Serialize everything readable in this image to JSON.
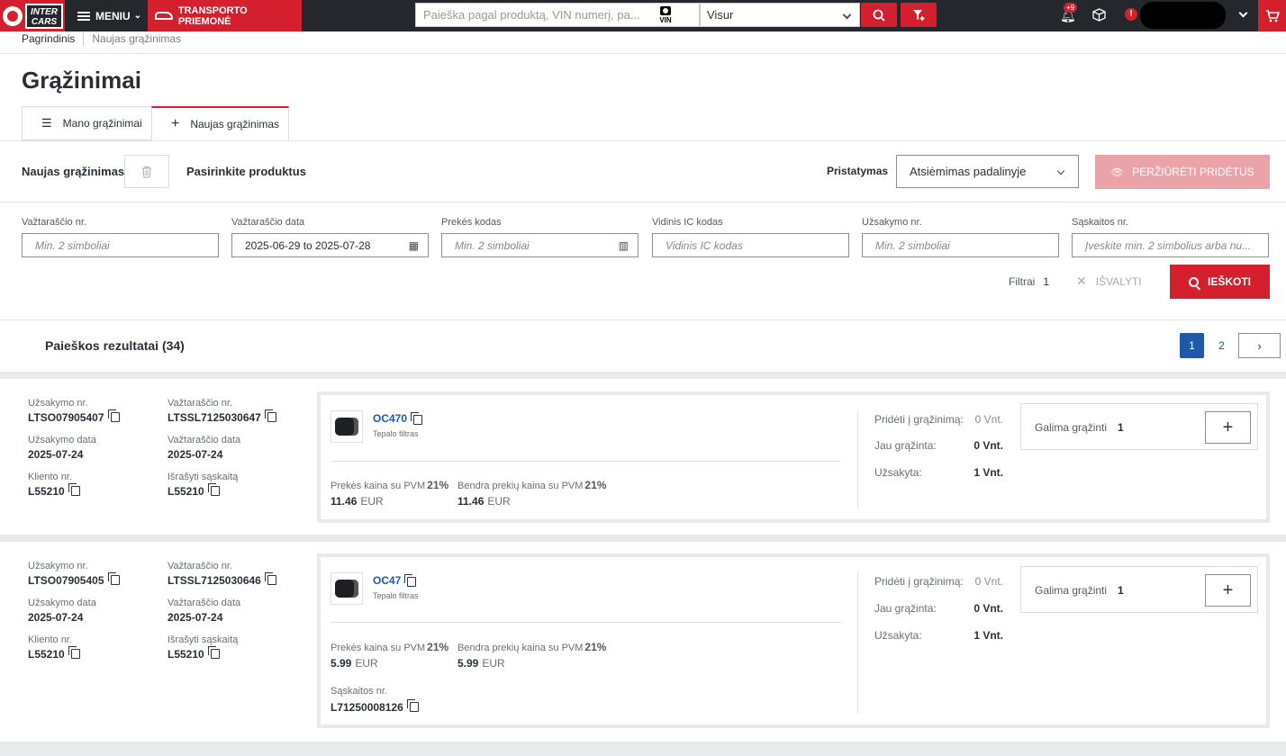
{
  "header": {
    "logo_text": "INTER CARS",
    "menu_label": "MENIU",
    "transport_label": "TRANSPORTO PRIEMONĖ",
    "search_placeholder": "Paieška pagal produktą, VIN numerį, pa...",
    "vin_label": "VIN",
    "scope_value": "Visur",
    "notif_badge": "+9"
  },
  "breadcrumb": [
    "Pagrindinis",
    "Naujas grąžinimas"
  ],
  "page_title": "Grąžinimai",
  "tabs": [
    {
      "label": "Mano grąžinimai"
    },
    {
      "label": "Naujas grąžinimas"
    }
  ],
  "toolbar": {
    "new_return": "Naujas grąžinimas",
    "pick_products": "Pasirinkite produktus",
    "delivery_label": "Pristatymas",
    "delivery_value": "Atsiėmimas padalinyje",
    "view_added": "PERŽIŪRĖTI PRIDĖTUS"
  },
  "filters": {
    "waybill_no": {
      "label": "Važtaraščio nr.",
      "placeholder": "Min. 2 simboliai"
    },
    "waybill_date": {
      "label": "Važtaraščio data",
      "value": "2025-06-29 to 2025-07-28"
    },
    "product_code": {
      "label": "Prekės kodas",
      "placeholder": "Min. 2 simboliai"
    },
    "ic_code": {
      "label": "Vidinis IC kodas",
      "placeholder": "Vidinis IC kodas"
    },
    "order_no": {
      "label": "Užsakymo nr.",
      "placeholder": "Min. 2 simboliai"
    },
    "invoice_no": {
      "label": "Sąskaitos nr.",
      "placeholder": "Įveskite min. 2 simbolius arba nu..."
    },
    "filters_label": "Filtrai",
    "filters_count": "1",
    "clear_label": "IŠVALYTI",
    "search_label": "IEŠKOTI"
  },
  "results": {
    "title": "Paieškos rezultatai (34)",
    "pages": [
      "1",
      "2"
    ],
    "next": "›"
  },
  "labels": {
    "order_no": "Užsakymo nr.",
    "waybill_no": "Važtaraščio nr.",
    "order_date": "Užsakymo data",
    "waybill_date": "Važtaraščio data",
    "client_no": "Kliento nr.",
    "invoiced": "Išrašyti sąskaitą",
    "unit_price": "Prekės kaina su PVM",
    "total_price": "Bendra prekių kaina su PVM",
    "vat": "21%",
    "currency": "EUR",
    "add_to_return": "Pridėti į grąžinimą:",
    "already_returned": "Jau grąžinta:",
    "ordered": "Užsakyta:",
    "can_return": "Galima grąžinti",
    "invoice_no": "Sąskaitos nr."
  },
  "items": [
    {
      "order_no": "LTSO07905407",
      "waybill_no": "LTSSL7125030647",
      "order_date": "2025-07-24",
      "waybill_date": "2025-07-24",
      "client_no": "L55210",
      "invoiced": "L55210",
      "code": "OC470",
      "desc": "Tepalo filtras",
      "unit_price": "11.46",
      "total_price": "11.46",
      "add_qty": "0 Vnt.",
      "returned_qty": "0 Vnt.",
      "ordered_qty": "1 Vnt.",
      "can_return": "1"
    },
    {
      "order_no": "LTSO07905405",
      "waybill_no": "LTSSL7125030646",
      "order_date": "2025-07-24",
      "waybill_date": "2025-07-24",
      "client_no": "L55210",
      "invoiced": "L55210",
      "code": "OC47",
      "desc": "Tepalo filtras",
      "unit_price": "5.99",
      "total_price": "5.99",
      "add_qty": "0 Vnt.",
      "returned_qty": "0 Vnt.",
      "ordered_qty": "1 Vnt.",
      "can_return": "1",
      "invoice_no": "L71250008126"
    }
  ]
}
